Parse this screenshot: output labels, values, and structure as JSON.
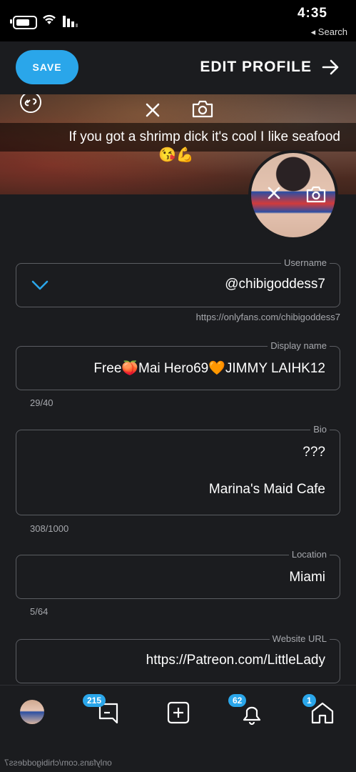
{
  "status_bar": {
    "time": "4:35",
    "back_label": "◂ Search"
  },
  "header": {
    "save_label": "SAVE",
    "title": "EDIT PROFILE"
  },
  "cover": {
    "caption": "If you got a shrimp dick it's cool I like seafood",
    "emoji": "😘💪"
  },
  "fields": {
    "username": {
      "label": "Username",
      "value": "@chibigoddess7",
      "helper": "https://onlyfans.com/chibigoddess7"
    },
    "display_name": {
      "label": "Display name",
      "value": "Free🍑Mai Hero69🧡JIMMY LAIHK12",
      "counter": "29/40"
    },
    "bio": {
      "label": "Bio",
      "line1": "???",
      "line2": "Marina's Maid Cafe",
      "counter": "308/1000"
    },
    "location": {
      "label": "Location",
      "value": "Miami",
      "counter": "5/64"
    },
    "website": {
      "label": "Website URL",
      "value": "https://Patreon.com/LittleLady"
    }
  },
  "bottom_nav": {
    "home_badge": "1",
    "notifications_badge": "62",
    "messages_badge": "215"
  },
  "url_bar": {
    "text": "onlyfans.com/chibigoddess7"
  },
  "colors": {
    "accent": "#2aa6ea",
    "background": "#1b1c1f",
    "border": "#5b5d62",
    "muted_text": "#a6a8ad"
  }
}
